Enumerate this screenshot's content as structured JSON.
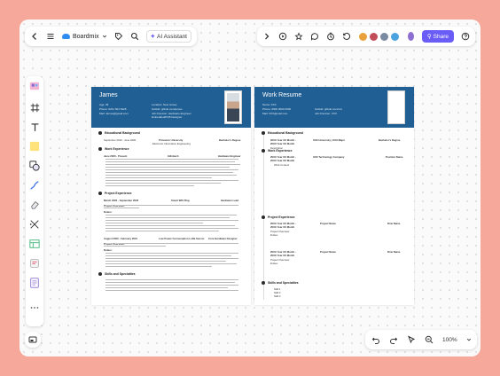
{
  "toolbar": {
    "brand": "Boardmix",
    "ai_label": "AI Assistant",
    "share_label": "Share"
  },
  "colors": {
    "accent": "#6a5cf6",
    "resume_header": "#1f5f94",
    "frame": "#f6a99a"
  },
  "zoom": "100%",
  "left_tools": [
    "template-icon",
    "frame-icon",
    "text-icon",
    "sticky-note-icon",
    "shape-icon",
    "pen-icon",
    "eraser-icon",
    "connector-icon",
    "table-icon",
    "mindmap-icon",
    "doc-icon",
    "more-icon"
  ],
  "resume1": {
    "name": "James",
    "age": "Age: 35",
    "phone": "Phone: 0231 504 6328",
    "email": "Mail: James@gmail.com",
    "location": "Location: New Jersey",
    "github": "GitHub: github.com/james",
    "job_intention": "Job Intention: Hardware Engineer",
    "job_intention2": "Embedded/PCB Designer",
    "edu_title": "Educational Background",
    "edu_date": "September 2016 - June 2020",
    "edu_school": "Princeton University",
    "edu_major": "Electronic Information Engineering",
    "edu_degree": "Bachelor's Degree",
    "work_title": "Work Experience",
    "work_date": "June 2020 - Present",
    "work_company": "Infinitech",
    "work_role": "Hardware Engineer",
    "project_title": "Project Experience",
    "proj1_date": "March 2022 - September 2022",
    "proj1_name": "Smart Wifi Plug",
    "proj1_role": "Hardware Lead",
    "proj1_overview": "Project Overview:",
    "proj1_duties": "Duties:",
    "proj2_date": "August 2020 - February 2021",
    "proj2_name": "Low Power Consumption LoRa Sensor",
    "proj2_role": "Core Hardware Designer",
    "proj2_overview": "Project Overview:",
    "proj2_duties": "Duties:",
    "skills_title": "Skills and Specialties"
  },
  "resume2": {
    "title": "Work Resume",
    "name": "Name: XXX",
    "phone": "Phone: 0000 0000 0000",
    "email": "Mail: XXX@mail.com",
    "github": "GitHub: github.com/xxx",
    "job_intention": "Job Intention: XXX",
    "edu_title": "Educational Background",
    "edu_date": "20XX Year XX Month - 20XX Year XX Month",
    "edu_school": "XXX University | XXX Major",
    "edu_degree": "Bachelor's Degree",
    "edu_desc": "Description",
    "work_title": "Work Experience",
    "work_date": "20XX Year XX Month - 20XX Year XX Month",
    "work_company": "XXX Technology Company",
    "work_role": "Position Name",
    "work_item1": "Work Content",
    "project_title": "Project Experience",
    "proj1_date": "20XX Year XX Month - 20XX Year XX Month",
    "proj1_name": "Project Name",
    "proj1_role": "Role Name",
    "proj_overview": "Project Overview:",
    "proj_duties": "Duties:",
    "proj2_date": "20XX Year XX Month - 20XX Year XX Month",
    "proj2_name": "Project Name",
    "proj2_role": "Role Name",
    "skills_title": "Skills and Specialties",
    "skill1": "Skill 1",
    "skill2": "Skill 2",
    "skill3": "Skill 3"
  }
}
